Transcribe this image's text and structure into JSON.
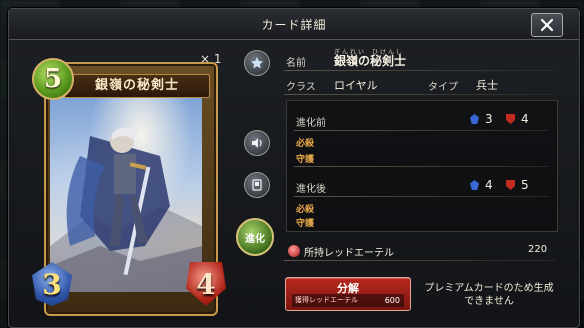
{
  "dialog": {
    "title": "カード詳細",
    "close_icon": "close-icon"
  },
  "card": {
    "name": "銀嶺の秘剣士",
    "cost": "5",
    "count": "× 1",
    "attack": "3",
    "defense": "4"
  },
  "details": {
    "name_label": "名前",
    "name_ruby_1": "ぎんれい",
    "name_ruby_2": "ひけんし",
    "name_value": "銀嶺の秘剣士",
    "class_label": "クラス",
    "class_value": "ロイヤル",
    "type_label": "タイプ",
    "type_value": "兵士",
    "pre_evolve": {
      "label": "進化前",
      "attack": "3",
      "defense": "4",
      "keyword_1": "必殺",
      "keyword_2": "守護"
    },
    "post_evolve": {
      "label": "進化後",
      "attack": "4",
      "defense": "5",
      "keyword_1": "必殺",
      "keyword_2": "守護"
    }
  },
  "side_buttons": {
    "evolve_label": "進化"
  },
  "ether": {
    "label": "所持レッドエーテル",
    "value": "220"
  },
  "craft": {
    "label": "分解",
    "cost_label": "獲得レッドエーテル",
    "cost_value": "600"
  },
  "note": "プレミアムカードのため生成できません",
  "colors": {
    "craft_red": "#b8281e",
    "cost_green": "#5b9a1e",
    "attack_blue": "#2c52a8",
    "defense_red": "#b22418",
    "keyword_orange": "#e8a94a"
  }
}
